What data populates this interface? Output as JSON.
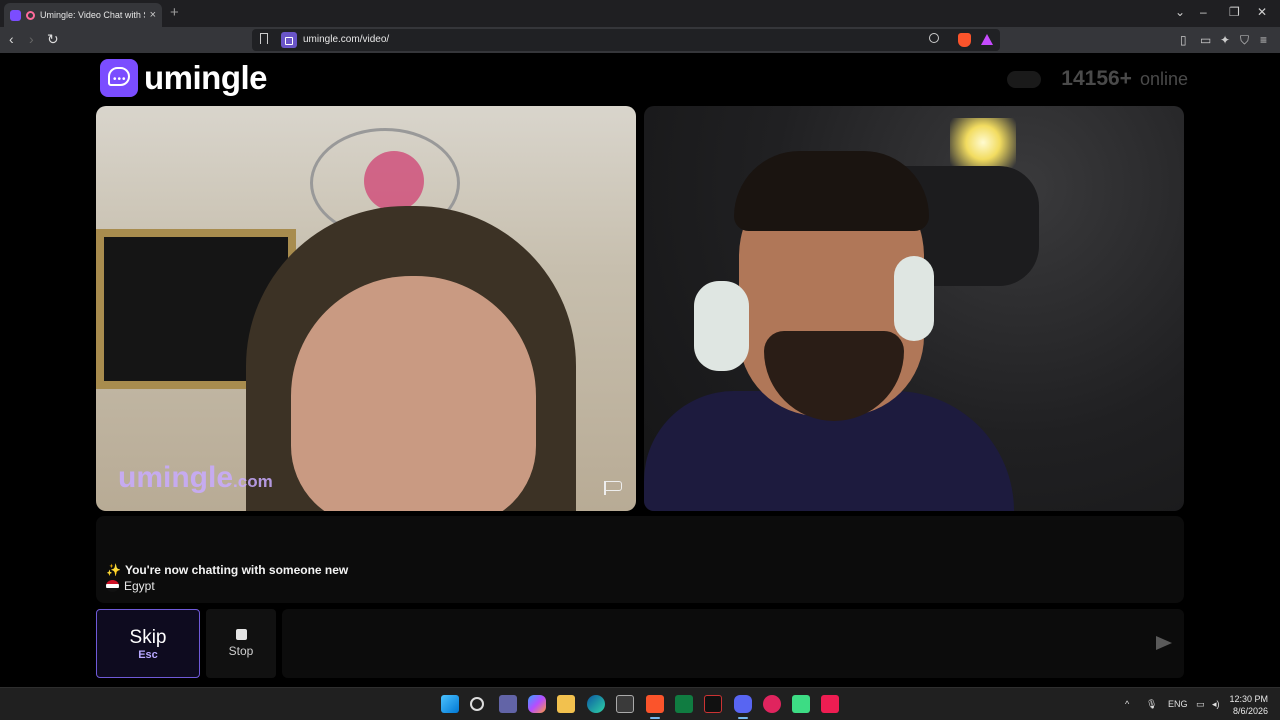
{
  "browser": {
    "tab_title": "Umingle: Video Chat with Str",
    "tab_close": "×",
    "new_tab": "+",
    "url": "umingle.com/video/",
    "window_controls": {
      "dropdown": "⌄",
      "minimize": "–",
      "restore": "❐",
      "close": "✕"
    },
    "nav": {
      "back": "‹",
      "forward": "›",
      "reload": "↻"
    },
    "toolbar_icons": [
      "sidebar-icon",
      "wallet-icon",
      "leo-ai-icon",
      "vpn-icon",
      "menu-icon"
    ]
  },
  "header": {
    "logo_text": "umingle",
    "online_count": "14156+",
    "online_label": "online"
  },
  "videos": {
    "stranger_watermark": "umingle",
    "stranger_watermark_domain": ".com"
  },
  "chat": {
    "status_icon": "✨",
    "status_message": "You're now chatting with someone new",
    "country": "Egypt"
  },
  "controls": {
    "skip_label": "Skip",
    "skip_key": "Esc",
    "stop_label": "Stop",
    "message_placeholder": ""
  },
  "taskbar": {
    "language": "ENG",
    "time": "12:30 PM",
    "date": "8/6/2026",
    "apps": [
      "start-icon",
      "search-icon",
      "teams-icon",
      "copilot-icon",
      "file-explorer-icon",
      "edge-icon",
      "store-icon",
      "brave-icon",
      "excel-icon",
      "capcut-icon",
      "discord-icon",
      "app-red-icon",
      "android-icon",
      "tiktok-icon"
    ]
  },
  "colors": {
    "brand": "#7b4dff",
    "skip_border": "#6f5ad8",
    "page_background": "#000000"
  }
}
